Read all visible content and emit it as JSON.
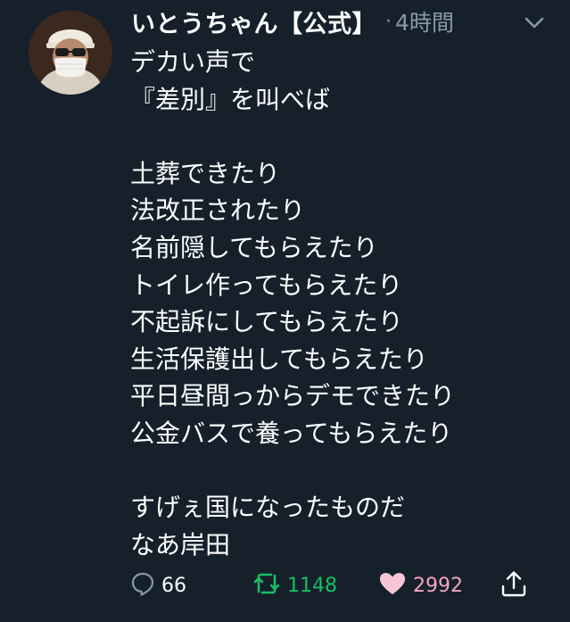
{
  "tweet": {
    "author_name": "いとうちゃん【公式】",
    "separator": "·",
    "time": "4時間",
    "lines": [
      "デカい声で",
      "『差別』を叫べば",
      "",
      "土葬できたり",
      "法改正されたり",
      "名前隠してもらえたり",
      "トイレ作ってもらえたり",
      "不起訴にしてもらえたり",
      "生活保護出してもらえたり",
      "平日昼間っからデモできたり",
      "公金バスで養ってもらえたり",
      "",
      "すげぇ国になったものだ",
      "なあ岸田"
    ]
  },
  "actions": {
    "reply_count": "66",
    "retweet_count": "1148",
    "like_count": "2992"
  },
  "icons": {
    "reply": "comment-bubble-icon",
    "retweet": "retweet-icon",
    "like": "heart-icon",
    "share": "share-icon",
    "menu": "chevron-down-icon"
  },
  "colors": {
    "background": "#15202b",
    "secondary_text": "#8899a6",
    "retweet_active": "#17bf63",
    "like_active": "#e0245e"
  }
}
